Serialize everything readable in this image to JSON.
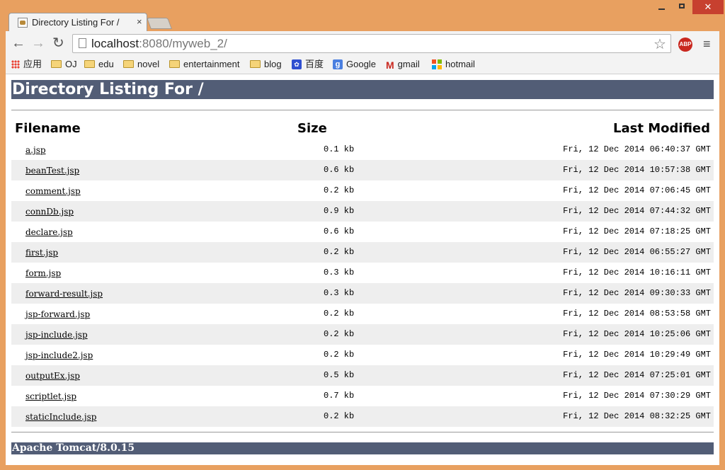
{
  "browser": {
    "tab_title": "Directory Listing For /",
    "tab_close": "×",
    "win_close": "✕",
    "url_host": "localhost",
    "url_rest": ":8080/myweb_2/",
    "nav_back": "←",
    "nav_forward": "→",
    "nav_reload": "↻",
    "star": "☆",
    "abp_label": "ABP",
    "menu": "≡",
    "bookmarks": [
      {
        "label": "应用",
        "icon": "apps-icon"
      },
      {
        "label": "OJ",
        "icon": "folder-icon"
      },
      {
        "label": "edu",
        "icon": "folder-icon"
      },
      {
        "label": "novel",
        "icon": "folder-icon"
      },
      {
        "label": "entertainment",
        "icon": "folder-icon"
      },
      {
        "label": "blog",
        "icon": "folder-icon"
      },
      {
        "label": "百度",
        "icon": "baidu-icon"
      },
      {
        "label": "Google",
        "icon": "google-icon"
      },
      {
        "label": "gmail",
        "icon": "gmail-icon"
      },
      {
        "label": "hotmail",
        "icon": "hotmail-icon"
      }
    ]
  },
  "page": {
    "heading": "Directory Listing For /",
    "columns": {
      "filename": "Filename",
      "size": "Size",
      "modified": "Last Modified"
    },
    "files": [
      {
        "name": "a.jsp",
        "size": "0.1 kb",
        "modified": "Fri, 12 Dec 2014 06:40:37 GMT"
      },
      {
        "name": "beanTest.jsp",
        "size": "0.6 kb",
        "modified": "Fri, 12 Dec 2014 10:57:38 GMT"
      },
      {
        "name": "comment.jsp",
        "size": "0.2 kb",
        "modified": "Fri, 12 Dec 2014 07:06:45 GMT"
      },
      {
        "name": "connDb.jsp",
        "size": "0.9 kb",
        "modified": "Fri, 12 Dec 2014 07:44:32 GMT"
      },
      {
        "name": "declare.jsp",
        "size": "0.6 kb",
        "modified": "Fri, 12 Dec 2014 07:18:25 GMT"
      },
      {
        "name": "first.jsp",
        "size": "0.2 kb",
        "modified": "Fri, 12 Dec 2014 06:55:27 GMT"
      },
      {
        "name": "form.jsp",
        "size": "0.3 kb",
        "modified": "Fri, 12 Dec 2014 10:16:11 GMT"
      },
      {
        "name": "forward-result.jsp",
        "size": "0.3 kb",
        "modified": "Fri, 12 Dec 2014 09:30:33 GMT"
      },
      {
        "name": "jsp-forward.jsp",
        "size": "0.2 kb",
        "modified": "Fri, 12 Dec 2014 08:53:58 GMT"
      },
      {
        "name": "jsp-include.jsp",
        "size": "0.2 kb",
        "modified": "Fri, 12 Dec 2014 10:25:06 GMT"
      },
      {
        "name": "jsp-include2.jsp",
        "size": "0.2 kb",
        "modified": "Fri, 12 Dec 2014 10:29:49 GMT"
      },
      {
        "name": "outputEx.jsp",
        "size": "0.5 kb",
        "modified": "Fri, 12 Dec 2014 07:25:01 GMT"
      },
      {
        "name": "scriptlet.jsp",
        "size": "0.7 kb",
        "modified": "Fri, 12 Dec 2014 07:30:29 GMT"
      },
      {
        "name": "staticInclude.jsp",
        "size": "0.2 kb",
        "modified": "Fri, 12 Dec 2014 08:32:25 GMT"
      }
    ],
    "footer": "Apache Tomcat/8.0.15"
  },
  "colors": {
    "header_bg": "#525d76",
    "row_alt_bg": "#eeeeee",
    "window_frame": "#e8a060",
    "close_button": "#c7402f"
  }
}
